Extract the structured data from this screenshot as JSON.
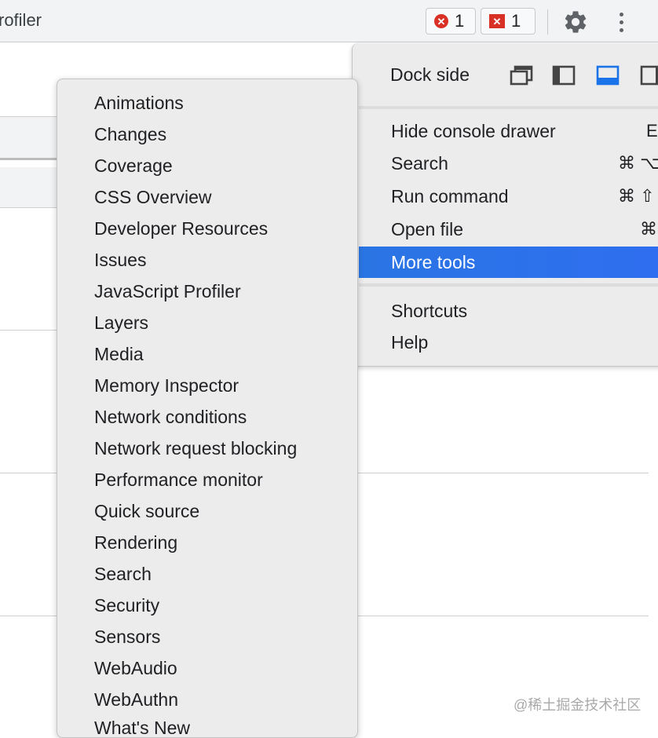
{
  "toolbar": {
    "title_fragment": "rofiler",
    "errors_count": "1",
    "issues_count": "1",
    "error_icon_glyph": "✕",
    "issue_icon_glyph": "✕"
  },
  "main_menu": {
    "dock_side_label": "Dock side",
    "dock_options": [
      "undock-icon",
      "dock-left-icon",
      "dock-bottom-icon",
      "dock-right-icon"
    ],
    "dock_selected": "dock-bottom-icon",
    "items": [
      {
        "label": "Hide console drawer",
        "shortcut": "E"
      },
      {
        "label": "Search",
        "shortcut": "⌘ ⌥"
      },
      {
        "label": "Run command",
        "shortcut": "⌘ ⇧"
      },
      {
        "label": "Open file",
        "shortcut": "⌘"
      },
      {
        "label": "More tools",
        "shortcut": ""
      }
    ],
    "help_items": [
      {
        "label": "Shortcuts"
      },
      {
        "label": "Help"
      }
    ]
  },
  "more_tools": [
    "Animations",
    "Changes",
    "Coverage",
    "CSS Overview",
    "Developer Resources",
    "Issues",
    "JavaScript Profiler",
    "Layers",
    "Media",
    "Memory Inspector",
    "Network conditions",
    "Network request blocking",
    "Performance monitor",
    "Quick source",
    "Rendering",
    "Search",
    "Security",
    "Sensors",
    "WebAudio",
    "WebAuthn",
    "What's New"
  ],
  "watermark": "@稀土掘金技术社区",
  "colors": {
    "accent": "#2f6ef0",
    "error": "#d93025",
    "menu_bg": "#ececec",
    "toolbar_bg": "#f1f3f4"
  }
}
